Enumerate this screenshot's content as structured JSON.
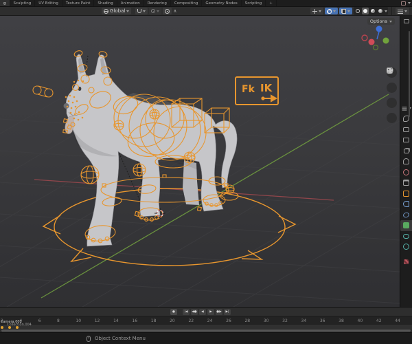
{
  "topbar": {
    "tabs": [
      {
        "label": "g",
        "name": "tab-modeling-partial",
        "active": true
      },
      {
        "label": "Sculpting",
        "name": "tab-sculpting"
      },
      {
        "label": "UV Editing",
        "name": "tab-uv-editing"
      },
      {
        "label": "Texture Paint",
        "name": "tab-texture-paint"
      },
      {
        "label": "Shading",
        "name": "tab-shading"
      },
      {
        "label": "Animation",
        "name": "tab-animation"
      },
      {
        "label": "Rendering",
        "name": "tab-rendering"
      },
      {
        "label": "Compositing",
        "name": "tab-compositing"
      },
      {
        "label": "Geometry Nodes",
        "name": "tab-geometry-nodes"
      },
      {
        "label": "Scripting",
        "name": "tab-scripting"
      },
      {
        "label": "+",
        "name": "add-workspace-button",
        "cls": "tab-add"
      }
    ]
  },
  "viewport_header": {
    "orientation_label": "Global"
  },
  "viewport": {
    "options_label": "Options",
    "fkik": {
      "fk_label": "Fk",
      "ik_label": "IK"
    }
  },
  "properties": {
    "tabs": [
      {
        "name": "properties-tab-tool-icon",
        "cls": "pi-tool"
      },
      {
        "name": "properties-tab-render-icon",
        "cls": "pi-render"
      },
      {
        "name": "properties-tab-output-icon",
        "cls": "pi-output"
      },
      {
        "name": "properties-tab-view-layer-icon",
        "cls": "pi-layers"
      },
      {
        "name": "properties-tab-scene-icon",
        "cls": "pi-scene"
      },
      {
        "name": "properties-tab-world-icon",
        "cls": "pi-world"
      },
      {
        "name": "properties-tab-collection-icon",
        "cls": "pi-coll"
      },
      {
        "name": "properties-tab-object-icon",
        "cls": "pi-object"
      },
      {
        "name": "properties-tab-constraints-icon",
        "cls": "pi-const"
      },
      {
        "name": "properties-tab-physics-icon",
        "cls": "pi-phys"
      },
      {
        "name": "properties-tab-object-data-icon",
        "cls": "pi-data",
        "active": true
      },
      {
        "name": "properties-tab-bone-icon",
        "cls": "pi-bone"
      },
      {
        "name": "properties-tab-bone-constraints-icon",
        "cls": "pi-bonec"
      },
      {
        "name": "properties-tab-texture-icon",
        "cls": "pi-tex"
      }
    ]
  },
  "timeline": {
    "frame_labels": [
      "2",
      "4",
      "6",
      "8",
      "10",
      "12",
      "14",
      "16",
      "18",
      "20",
      "22",
      "24",
      "26",
      "28",
      "30",
      "32",
      "34",
      "36",
      "38",
      "40",
      "42",
      "44"
    ],
    "keyframes": [
      {
        "frame": "2"
      },
      {
        "frame": "3"
      },
      {
        "frame": "4"
      }
    ],
    "channels": {
      "channel1": "Camera.002",
      "channel2": "Collection.004"
    },
    "playback": [
      {
        "glyph": "●",
        "name": "auto-keying-button",
        "cls": "gap"
      },
      {
        "glyph": "|◀",
        "name": "jump-to-start-button"
      },
      {
        "glyph": "◀●",
        "name": "previous-keyframe-button"
      },
      {
        "glyph": "◀",
        "name": "play-reverse-button"
      },
      {
        "glyph": "▶",
        "name": "play-button"
      },
      {
        "glyph": "●▶",
        "name": "next-keyframe-button"
      },
      {
        "glyph": "▶|",
        "name": "jump-to-end-button"
      }
    ]
  },
  "statusbar": {
    "context_label": "Object Context Menu"
  },
  "colors": {
    "rig_orange": "#e8962e",
    "selection_blue": "#4772b3",
    "axis_green": "#6f9b3f",
    "axis_red": "#a84a50",
    "keyframe_orange": "#e0a12f"
  }
}
